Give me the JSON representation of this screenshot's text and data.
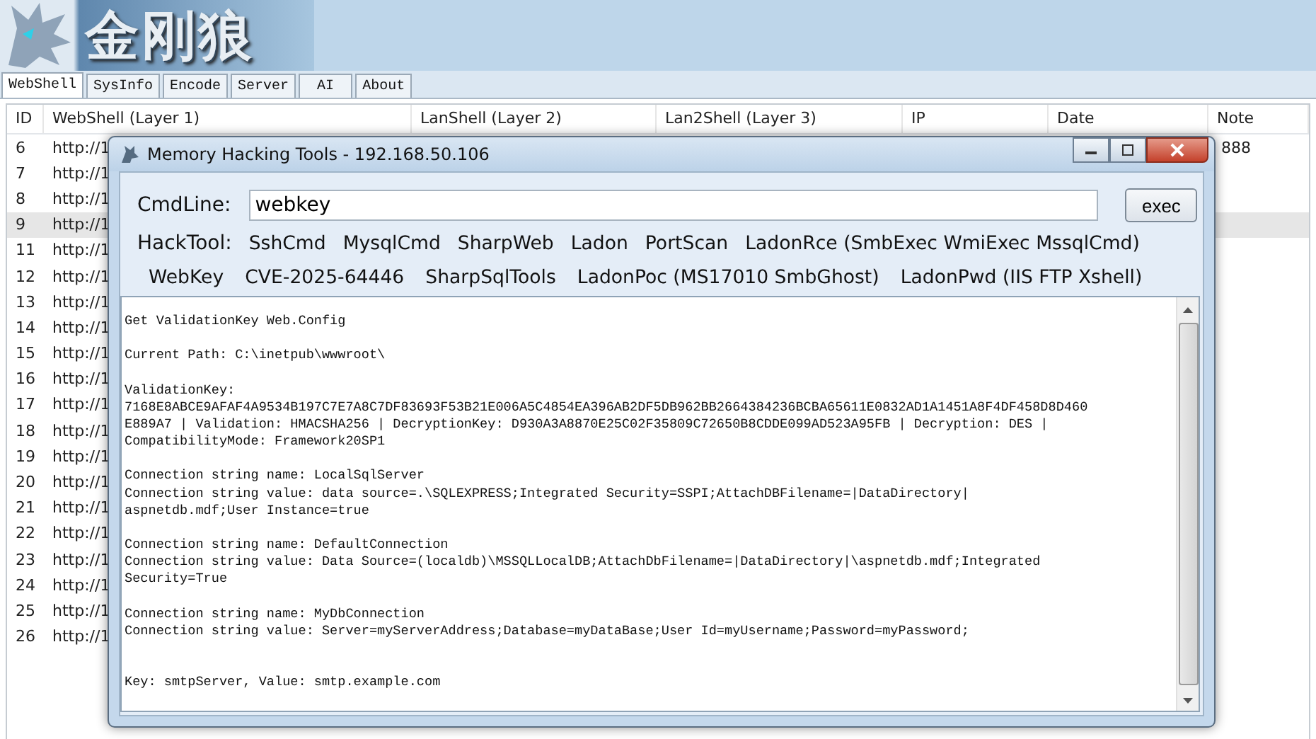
{
  "app": {
    "title": "金刚狼"
  },
  "tabs": [
    {
      "label": "WebShell",
      "selected": true
    },
    {
      "label": "SysInfo",
      "selected": false
    },
    {
      "label": "Encode",
      "selected": false
    },
    {
      "label": "Server",
      "selected": false
    },
    {
      "label": "AI",
      "selected": false
    },
    {
      "label": "About",
      "selected": false
    }
  ],
  "table": {
    "columns": [
      "ID",
      "WebShell (Layer 1)",
      "LanShell (Layer 2)",
      "Lan2Shell (Layer 3)",
      "IP",
      "Date",
      "Note"
    ],
    "rows": [
      {
        "id": "6",
        "webshell": "http://1",
        "note": "888",
        "selected": false
      },
      {
        "id": "7",
        "webshell": "http://1",
        "selected": false
      },
      {
        "id": "8",
        "webshell": "http://1",
        "selected": false
      },
      {
        "id": "9",
        "webshell": "http://1",
        "selected": true
      },
      {
        "id": "11",
        "webshell": "http://1",
        "selected": false
      },
      {
        "id": "12",
        "webshell": "http://1",
        "selected": false
      },
      {
        "id": "13",
        "webshell": "http://1",
        "selected": false
      },
      {
        "id": "14",
        "webshell": "http://1",
        "selected": false
      },
      {
        "id": "15",
        "webshell": "http://1",
        "selected": false
      },
      {
        "id": "16",
        "webshell": "http://1",
        "selected": false
      },
      {
        "id": "17",
        "webshell": "http://1",
        "selected": false
      },
      {
        "id": "18",
        "webshell": "http://1",
        "selected": false
      },
      {
        "id": "19",
        "webshell": "http://1",
        "selected": false
      },
      {
        "id": "20",
        "webshell": "http://1",
        "selected": false
      },
      {
        "id": "21",
        "webshell": "http://1",
        "selected": false
      },
      {
        "id": "22",
        "webshell": "http://1",
        "selected": false
      },
      {
        "id": "23",
        "webshell": "http://1",
        "selected": false
      },
      {
        "id": "24",
        "webshell": "http://1",
        "selected": false
      },
      {
        "id": "25",
        "webshell": "http://1",
        "selected": false
      },
      {
        "id": "26",
        "webshell": "http://1",
        "selected": false
      }
    ]
  },
  "dialog": {
    "title": "Memory Hacking Tools - 192.168.50.106",
    "cmdline": {
      "label": "CmdLine:",
      "value": "webkey"
    },
    "exec_button": "exec",
    "hacktool_label": "HackTool:",
    "tools_row1": [
      "SshCmd",
      "MysqlCmd",
      "SharpWeb",
      "Ladon",
      "PortScan",
      "LadonRce (SmbExec WmiExec MssqlCmd)"
    ],
    "tools_row2": [
      "WebKey",
      "CVE-2025-64446",
      "SharpSqlTools",
      "LadonPoc (MS17010 SmbGhost)",
      "LadonPwd (IIS FTP Xshell)"
    ],
    "output": "Get ValidationKey Web.Config\n\nCurrent Path: C:\\inetpub\\wwwroot\\\n\nValidationKey:\n7168E8ABCE9AFAF4A9534B197C7E7A8C7DF83693F53B21E006A5C4854EA396AB2DF5DB962BB2664384236BCBA65611E0832AD1A1451A8F4DF458D8D460\nE889A7 | Validation: HMACSHA256 | DecryptionKey: D930A3A8870E25C02F35809C72650B8CDDE099AD523A95FB | Decryption: DES |\nCompatibilityMode: Framework20SP1\n\nConnection string name: LocalSqlServer\nConnection string value: data source=.\\SQLEXPRESS;Integrated Security=SSPI;AttachDBFilename=|DataDirectory|\naspnetdb.mdf;User Instance=true\n\nConnection string name: DefaultConnection\nConnection string value: Data Source=(localdb)\\MSSQLLocalDB;AttachDbFilename=|DataDirectory|\\aspnetdb.mdf;Integrated\nSecurity=True\n\nConnection string name: MyDbConnection\nConnection string value: Server=myServerAddress;Database=myDataBase;User Id=myUsername;Password=myPassword;\n\n\nKey: smtpServer, Value: smtp.example.com"
  }
}
